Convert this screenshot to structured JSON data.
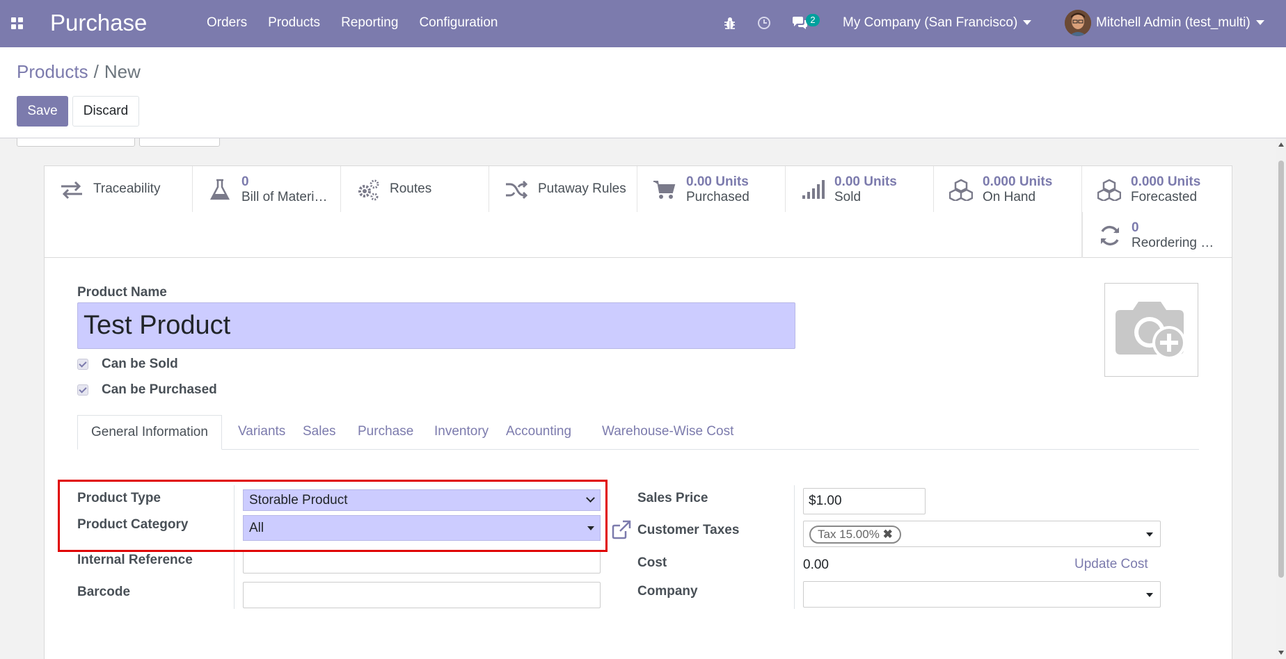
{
  "navbar": {
    "app_title": "Purchase",
    "menu": [
      "Orders",
      "Products",
      "Reporting",
      "Configuration"
    ],
    "messages_count": "2",
    "company": "My Company (San Francisco)",
    "user": "Mitchell Admin (test_multi)",
    "icons": [
      "apps-icon",
      "bug-icon",
      "clock-icon",
      "chat-icon"
    ]
  },
  "breadcrumb": {
    "parent": "Products",
    "separator": "/",
    "current": "New"
  },
  "actions": {
    "save": "Save",
    "discard": "Discard"
  },
  "smart_buttons": [
    {
      "icon": "traceability-icon",
      "value": "",
      "label": "Traceability"
    },
    {
      "icon": "flask-icon",
      "value": "0",
      "label": "Bill of Materi…"
    },
    {
      "icon": "gears-icon",
      "value": "",
      "label": "Routes"
    },
    {
      "icon": "shuffle-icon",
      "value": "",
      "label": "Putaway Rules"
    },
    {
      "icon": "cart-icon",
      "value": "0.00 Units",
      "label": "Purchased"
    },
    {
      "icon": "signal-icon",
      "value": "0.00 Units",
      "label": "Sold"
    },
    {
      "icon": "cubes-icon",
      "value": "0.000 Units",
      "label": "On Hand"
    },
    {
      "icon": "cubes-icon",
      "value": "0.000 Units",
      "label": "Forecasted"
    },
    {
      "icon": "refresh-icon",
      "value": "0",
      "label": "Reordering …"
    }
  ],
  "product": {
    "name_label": "Product Name",
    "name": "Test Product",
    "can_be_sold": "Can be Sold",
    "can_be_purchased": "Can be Purchased"
  },
  "tabs": [
    "General Information",
    "Variants",
    "Sales",
    "Purchase",
    "Inventory",
    "Accounting",
    "Warehouse-Wise Cost"
  ],
  "general": {
    "product_type_label": "Product Type",
    "product_type": "Storable Product",
    "product_category_label": "Product Category",
    "product_category": "All",
    "internal_reference_label": "Internal Reference",
    "internal_reference": "",
    "barcode_label": "Barcode",
    "barcode": "",
    "sales_price_label": "Sales Price",
    "sales_price": "$1.00",
    "customer_taxes_label": "Customer Taxes",
    "customer_tax_tag": "Tax 15.00%",
    "cost_label": "Cost",
    "cost": "0.00",
    "update_cost": "Update Cost",
    "company_label": "Company",
    "company": ""
  },
  "colors": {
    "navbar": "#7c7bad",
    "accent": "#7c7bad",
    "highlight_box": "#e00000",
    "required_field": "#ccccff"
  }
}
